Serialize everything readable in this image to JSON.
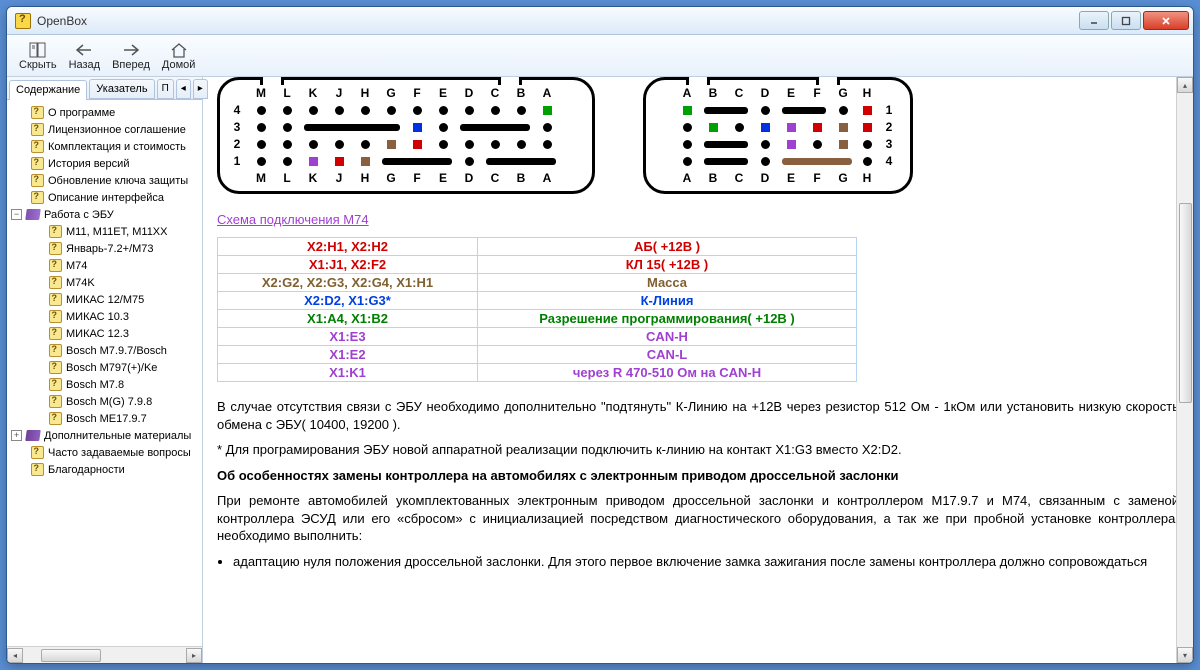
{
  "window": {
    "title": "OpenBox"
  },
  "toolbar": {
    "hide": "Скрыть",
    "back": "Назад",
    "forward": "Вперед",
    "home": "Домой"
  },
  "tabs": {
    "contents": "Содержание",
    "index": "Указатель",
    "search": "П"
  },
  "tree": {
    "n0": "О программе",
    "n1": "Лицензионное соглашение",
    "n2": "Комплектация и стоимость",
    "n3": "История версий",
    "n4": "Обновление ключа защиты",
    "n5": "Описание интерфейса",
    "n6": "Работа с ЭБУ",
    "n6_0": "M11, M11ET, M11XX",
    "n6_1": "Январь-7.2+/M73",
    "n6_2": "M74",
    "n6_3": "M74K",
    "n6_4": "МИКАС 12/M75",
    "n6_5": "МИКАС 10.3",
    "n6_6": "МИКАС 12.3",
    "n6_7": "Bosch M7.9.7/Bosch",
    "n6_8": "Bosch M797(+)/Ke",
    "n6_9": "Bosch M7.8",
    "n6_10": "Bosch M(G) 7.9.8",
    "n6_11": "Bosch ME17.9.7",
    "n7": "Дополнительные материалы",
    "n8": "Часто задаваемые вопросы",
    "n9": "Благодарности"
  },
  "content": {
    "conn_cols_left": [
      "M",
      "L",
      "K",
      "J",
      "H",
      "G",
      "F",
      "E",
      "D",
      "C",
      "B",
      "A"
    ],
    "conn_cols_right": [
      "A",
      "B",
      "C",
      "D",
      "E",
      "F",
      "G",
      "H"
    ],
    "link": "Схема подключения M74",
    "pins": [
      {
        "a": "X2:H1, X2:H2",
        "b": "АБ( +12В )",
        "cls": "c-red"
      },
      {
        "a": "X1:J1, X2:F2",
        "b": "КЛ 15( +12В )",
        "cls": "c-red"
      },
      {
        "a": "X2:G2, X2:G3, X2:G4, X1:H1",
        "b": "Масса",
        "cls": "c-brown"
      },
      {
        "a": "X2:D2, X1:G3*",
        "b": "К-Линия",
        "cls": "c-blue"
      },
      {
        "a": "X1:A4, X1:B2",
        "b": "Разрешение программирования( +12В )",
        "cls": "c-green"
      },
      {
        "a": "X1:E3",
        "b": "CAN-H",
        "cls": "c-purple"
      },
      {
        "a": "X1:E2",
        "b": "CAN-L",
        "cls": "c-purple"
      },
      {
        "a": "X1:K1",
        "b": "через R 470-510 Ом на CAN-H",
        "cls": "c-purple"
      }
    ],
    "p1": "В случае отсутствия связи с ЭБУ необходимо дополнительно \"подтянуть\" К-Линию на +12В через резистор 512 Ом - 1кОм или установить низкую скорость обмена с ЭБУ( 10400, 19200 ).",
    "p2": "* Для програмирования ЭБУ новой аппаратной реализации подключить к-линию на контакт X1:G3 вместо X2:D2.",
    "h1": "Об особенностях замены контроллера на автомобилях с электронным приводом дроссельной заслонки",
    "p3": "При ремонте автомобилей укомплектованных электронным приводом дроссельной заслонки и контроллером M17.9.7 и M74, связанным с заменой контроллера ЭСУД или его «сбросом» с инициализацией посредством диагностического оборудования, а так же при пробной установке контроллера, необходимо выполнить:",
    "li1": "адаптацию нуля положения дроссельной заслонки. Для этого первое включение замка зажигания после замены контроллера должно сопровождаться"
  }
}
